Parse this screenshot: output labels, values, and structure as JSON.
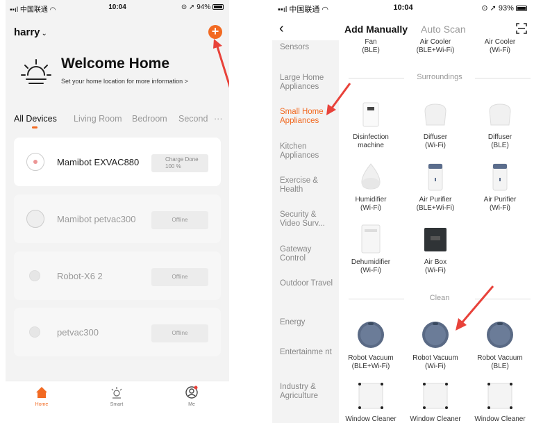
{
  "left": {
    "status": {
      "carrier": "中国联通",
      "time": "10:04",
      "battery": "94%"
    },
    "user": {
      "name": "harry"
    },
    "welcome": {
      "title": "Welcome Home",
      "subtitle": "Set your home location for more information"
    },
    "rooms": [
      "All Devices",
      "Living Room",
      "Bedroom",
      "Second",
      "···"
    ],
    "devices": [
      {
        "name": "Mamibot EXVAC880",
        "status_line1": "Charge Done",
        "status_line2": "100 %",
        "online": true
      },
      {
        "name": "Mamibot petvac300",
        "status": "Offline",
        "online": false
      },
      {
        "name": "Robot-X6 2",
        "status": "Offline",
        "online": false
      },
      {
        "name": "petvac300",
        "status": "Offline",
        "online": false
      }
    ],
    "tabbar": [
      {
        "label": "Home",
        "icon": "home-icon"
      },
      {
        "label": "Smart",
        "icon": "sun-icon"
      },
      {
        "label": "Me",
        "icon": "profile-icon"
      }
    ],
    "accent": "#f26a22"
  },
  "right": {
    "status": {
      "carrier": "中国联通",
      "time": "10:04",
      "battery": "93%"
    },
    "nav": {
      "active_tab": "Add Manually",
      "other_tab": "Auto Scan"
    },
    "categories": [
      "Sensors",
      "Large Home Appliances",
      "Small Home Appliances",
      "Kitchen Appliances",
      "Exercise & Health",
      "Security & Video Surv...",
      "Gateway Control",
      "Outdoor Travel",
      "Energy",
      "Entertainme nt",
      "Industry & Agriculture"
    ],
    "active_category": "Small Home Appliances",
    "top_row": [
      {
        "name": "Fan",
        "proto": "(BLE)"
      },
      {
        "name": "Air Cooler",
        "proto": "(BLE+Wi-Fi)"
      },
      {
        "name": "Air Cooler",
        "proto": "(Wi-Fi)"
      }
    ],
    "sections": {
      "surroundings": "Surroundings",
      "clean": "Clean"
    },
    "surroundings": [
      {
        "name": "Disinfection",
        "proto": "machine"
      },
      {
        "name": "Diffuser",
        "proto": "(Wi-Fi)"
      },
      {
        "name": "Diffuser",
        "proto": "(BLE)"
      },
      {
        "name": "Humidifier",
        "proto": "(Wi-Fi)"
      },
      {
        "name": "Air Purifier",
        "proto": "(BLE+Wi-Fi)"
      },
      {
        "name": "Air Purifier",
        "proto": "(Wi-Fi)"
      },
      {
        "name": "Dehumidifier",
        "proto": "(Wi-Fi)"
      },
      {
        "name": "Air Box",
        "proto": "(Wi-Fi)"
      }
    ],
    "clean": [
      {
        "name": "Robot Vacuum",
        "proto": "(BLE+Wi-Fi)"
      },
      {
        "name": "Robot Vacuum",
        "proto": "(Wi-Fi)"
      },
      {
        "name": "Robot Vacuum",
        "proto": "(BLE)"
      },
      {
        "name": "Window Cleaner",
        "proto": ""
      },
      {
        "name": "Window Cleaner",
        "proto": ""
      },
      {
        "name": "Window Cleaner",
        "proto": ""
      }
    ]
  },
  "annotation_color": "#e8423a"
}
